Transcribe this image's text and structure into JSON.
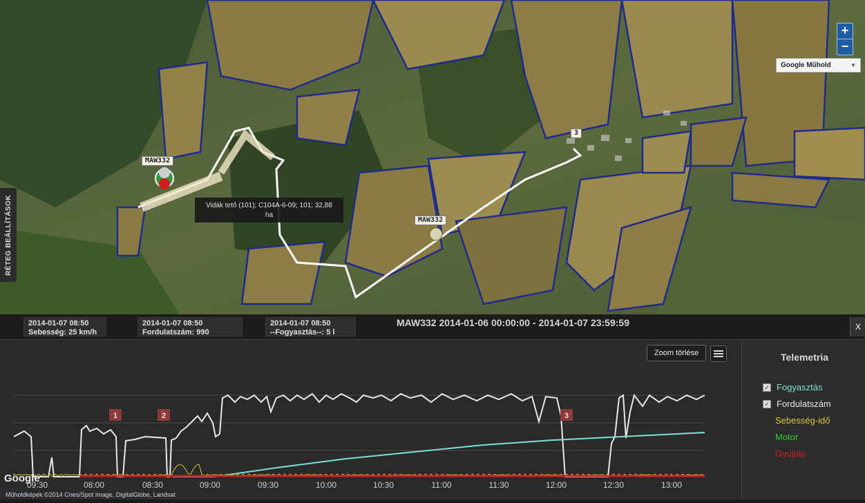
{
  "map": {
    "side_tab": "RÉTEG BEÁLLÍTÁSOK",
    "zoom_in": "+",
    "zoom_out": "−",
    "layer_select": "Google Műhold",
    "layer_arrow": "▼",
    "tooltip": [
      "Vidák tető (101); C104A-6-09; 101; 32,88",
      "ha"
    ],
    "vehicle_labels": [
      "MAW332",
      "MAW332",
      "3"
    ],
    "marker_icon": "car-marker-icon",
    "copyright": "Műholdképek ©2014 Cnes/Spot Image, DigitalGlobe, Landsat",
    "google_logo": "Google"
  },
  "panel": {
    "title": "MAW332 2014-01-06 00:00:00 - 2014-01-07 23:59:59",
    "close": "X",
    "info_boxes": [
      {
        "time": "2014-01-07 08:50",
        "value": "Sebesség: 25 km/h"
      },
      {
        "time": "2014-01-07 08:50",
        "value": "Fordulatszám: 990"
      },
      {
        "time": "2014-01-07 08:50",
        "value": "--Fogyasztás--: 5 l"
      }
    ],
    "zoom_reset": "Zoom törlése",
    "menu_icon": "hamburger-menu-icon"
  },
  "legend": {
    "title": "Telemetria",
    "items": [
      {
        "label": "Fogyasztás",
        "checked": true,
        "color": "#7fe0d6"
      },
      {
        "label": "Fordulatszám",
        "checked": true,
        "color": "#e8e8e8"
      },
      {
        "label": "Sebesség-idő",
        "checked": false,
        "color": "#d8c83a"
      },
      {
        "label": "Motor",
        "checked": false,
        "color": "#2fd12f"
      },
      {
        "label": "Gyújtás",
        "checked": false,
        "color": "#d02020"
      }
    ]
  },
  "chart_data": {
    "type": "line",
    "x_ticks": [
      "09:30",
      "08:00",
      "08:30",
      "09:00",
      "09:30",
      "10:00",
      "10:30",
      "11:00",
      "11:30",
      "12:00",
      "12:30",
      "13:00"
    ],
    "markers": [
      "1",
      "2",
      "3"
    ],
    "series": [
      {
        "name": "Fordulatszám",
        "color": "#e8e8e8"
      },
      {
        "name": "Fogyasztás",
        "color": "#7fe0d6"
      },
      {
        "name": "Sebesség-idő",
        "color": "#d8c83a"
      },
      {
        "name": "Gyújtás",
        "color": "#d02020"
      }
    ]
  }
}
